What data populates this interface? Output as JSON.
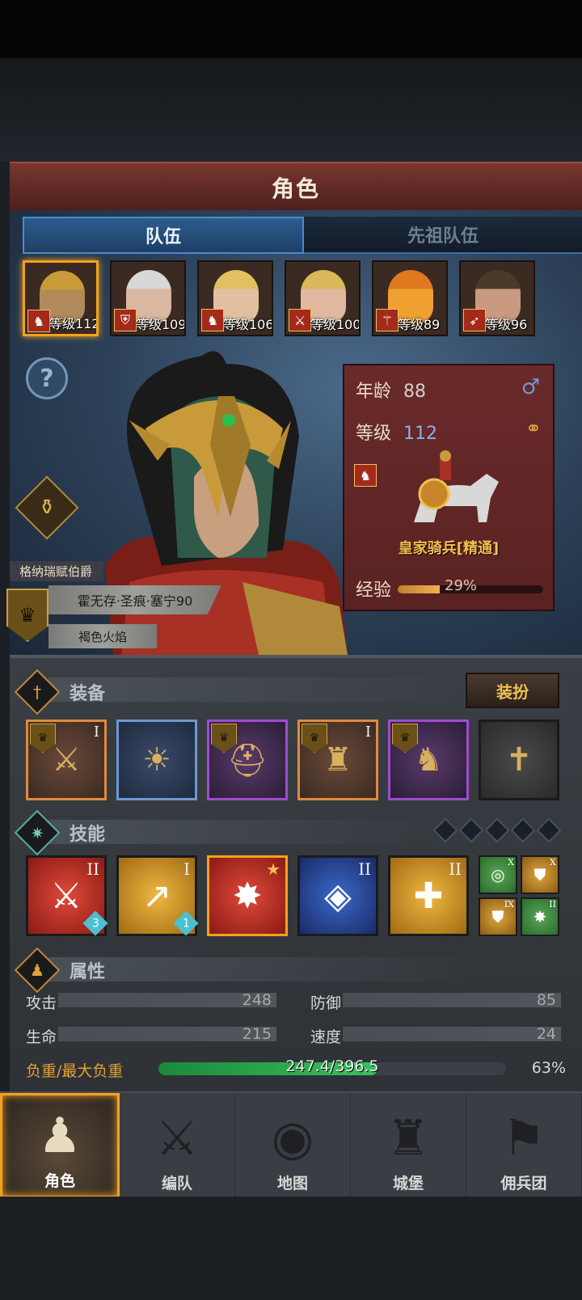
{
  "header": {
    "title": "角色"
  },
  "tabs": [
    {
      "label": "队伍",
      "active": true
    },
    {
      "label": "先祖队伍",
      "active": false
    }
  ],
  "heroes": [
    {
      "level_text": "等级112",
      "class_icon": "horse-icon",
      "selected": true,
      "hair": "#c89a3a",
      "skin": "#b08a5a"
    },
    {
      "level_text": "等级109",
      "class_icon": "shield-icon",
      "selected": false,
      "hair": "#d8d8d8",
      "skin": "#d8b8a0"
    },
    {
      "level_text": "等级106",
      "class_icon": "horse-icon",
      "selected": false,
      "hair": "#e0c060",
      "skin": "#e0c0a0"
    },
    {
      "level_text": "等级100",
      "class_icon": "sword-icon",
      "selected": false,
      "hair": "#d8b858",
      "skin": "#e0b8a0"
    },
    {
      "level_text": "等级89",
      "class_icon": "staff-icon",
      "selected": false,
      "hair": "#e07820",
      "skin": "#f0a030"
    },
    {
      "level_text": "等级96",
      "class_icon": "bow-icon",
      "selected": false,
      "hair": "#4a3a2a",
      "skin": "#c89a80"
    }
  ],
  "character": {
    "age_label": "年龄",
    "age": "88",
    "level_label": "等级",
    "level": "112",
    "unit_name": "皇家骑兵[精通]",
    "exp_label": "经验",
    "exp_pct_text": "29%",
    "exp_fraction": 0.29,
    "faction": "格纳瑞赋伯爵",
    "title1": "霍无存·圣痕·塞宁90",
    "title2": "褐色火焰"
  },
  "equipment": {
    "section_title": "装备",
    "dress_button": "装扮",
    "slots": [
      {
        "name": "armor-slot",
        "icon": "gauntlet",
        "glyph": "⚔",
        "rarity": "orange",
        "badge": true,
        "tier": "I"
      },
      {
        "name": "shield-slot",
        "icon": "sun-shield",
        "glyph": "☀",
        "rarity": "blue",
        "badge": false,
        "tier": ""
      },
      {
        "name": "helmet-slot",
        "icon": "helmet",
        "glyph": "⛑",
        "rarity": "purple",
        "badge": true,
        "tier": ""
      },
      {
        "name": "chest-slot",
        "icon": "chest-armor",
        "glyph": "♜",
        "rarity": "orange",
        "badge": true,
        "tier": "I"
      },
      {
        "name": "boots-slot",
        "icon": "boots",
        "glyph": "♞",
        "rarity": "purple",
        "badge": true,
        "tier": ""
      },
      {
        "name": "rosary-slot",
        "icon": "rosary",
        "glyph": "✝",
        "rarity": "plain",
        "badge": false,
        "tier": ""
      }
    ]
  },
  "skills": {
    "section_title": "技能",
    "items": [
      {
        "name": "skill-1",
        "glyph": "⚔",
        "color": "red",
        "tier": "II",
        "level": "3",
        "selected": false
      },
      {
        "name": "skill-2",
        "glyph": "↗",
        "color": "gold",
        "tier": "I",
        "level": "1",
        "selected": false
      },
      {
        "name": "skill-3",
        "glyph": "✸",
        "color": "red",
        "tier": "★",
        "level": "",
        "selected": true
      },
      {
        "name": "skill-4",
        "glyph": "◈",
        "color": "blue",
        "tier": "II",
        "level": "",
        "selected": false
      },
      {
        "name": "skill-5",
        "glyph": "✚",
        "color": "gold",
        "tier": "II",
        "level": "",
        "selected": false
      }
    ],
    "mini": [
      {
        "glyph": "◎",
        "color": "green",
        "tier": "X"
      },
      {
        "glyph": "⛊",
        "color": "gold",
        "tier": "X"
      },
      {
        "glyph": "⛊",
        "color": "gold",
        "tier": "IX"
      },
      {
        "glyph": "✸",
        "color": "green",
        "tier": "II"
      }
    ]
  },
  "attributes": {
    "section_title": "属性",
    "attack_label": "攻击",
    "attack": "248",
    "defense_label": "防御",
    "defense": "85",
    "health_label": "生命",
    "health": "215",
    "speed_label": "速度",
    "speed": "24",
    "load_label": "负重/最大负重",
    "load_text": "247.4/396.5",
    "load_pct_text": "63%",
    "load_fraction": 0.63
  },
  "nav": [
    {
      "label": "角色",
      "glyph": "♟",
      "active": true,
      "name": "nav-character"
    },
    {
      "label": "编队",
      "glyph": "⚔",
      "active": false,
      "name": "nav-formation"
    },
    {
      "label": "地图",
      "glyph": "◉",
      "active": false,
      "name": "nav-map"
    },
    {
      "label": "城堡",
      "glyph": "♜",
      "active": false,
      "name": "nav-castle"
    },
    {
      "label": "佣兵团",
      "glyph": "⚑",
      "active": false,
      "name": "nav-mercenary"
    }
  ],
  "colors": {
    "accent_orange": "#f2a21c",
    "header_red": "#6a2a26",
    "panel_blue": "#2a3e55",
    "exp_gold": "#f0b050",
    "load_green": "#3ac060"
  }
}
